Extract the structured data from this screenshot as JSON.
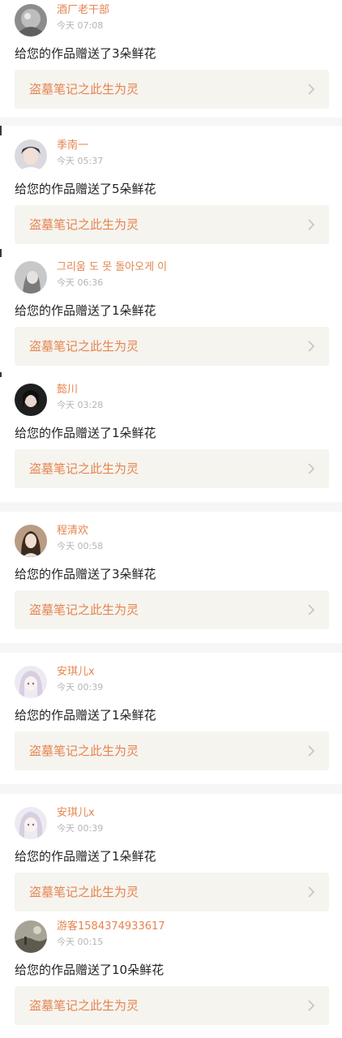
{
  "colors": {
    "accent": "#e6844f",
    "link_background": "#f5f4ef",
    "separator": "#f6f6f6",
    "time_text": "#b5b5b5"
  },
  "notifications": [
    {
      "user": "酒厂老干部",
      "time": "今天 07:08",
      "message": "给您的作品赠送了3朵鲜花",
      "work_title": "盗墓笔记之此生为灵",
      "avatar_icon": "avatar-photo-gray-icon"
    },
    {
      "user": "季南一",
      "time": "今天 05:37",
      "message": "给您的作品赠送了5朵鲜花",
      "work_title": "盗墓笔记之此生为灵",
      "avatar_icon": "avatar-photo-portrait-icon"
    },
    {
      "user": "그리움 도 못 돌아오게 이",
      "time": "今天 06:36",
      "message": "给您的作品赠送了1朵鲜花",
      "work_title": "盗墓笔记之此生为灵",
      "avatar_icon": "avatar-photo-gray-icon"
    },
    {
      "user": "懿川",
      "time": "今天 03:28",
      "message": "给您的作品赠送了1朵鲜花",
      "work_title": "盗墓笔记之此生为灵",
      "avatar_icon": "avatar-photo-dark-icon"
    },
    {
      "user": "程清欢",
      "time": "今天 00:58",
      "message": "给您的作品赠送了3朵鲜花",
      "work_title": "盗墓笔记之此生为灵",
      "avatar_icon": "avatar-photo-warm-icon"
    },
    {
      "user": "安琪儿x",
      "time": "今天 00:39",
      "message": "给您的作品赠送了1朵鲜花",
      "work_title": "盗墓笔记之此生为灵",
      "avatar_icon": "avatar-anime-girl-icon"
    },
    {
      "user": "安琪儿x",
      "time": "今天 00:39",
      "message": "给您的作品赠送了1朵鲜花",
      "work_title": "盗墓笔记之此生为灵",
      "avatar_icon": "avatar-anime-girl-icon"
    },
    {
      "user": "游客1584374933617",
      "time": "今天 00:15",
      "message": "给您的作品赠送了10朵鲜花",
      "work_title": "盗墓笔记之此生为灵",
      "avatar_icon": "avatar-photo-landscape-icon"
    }
  ]
}
